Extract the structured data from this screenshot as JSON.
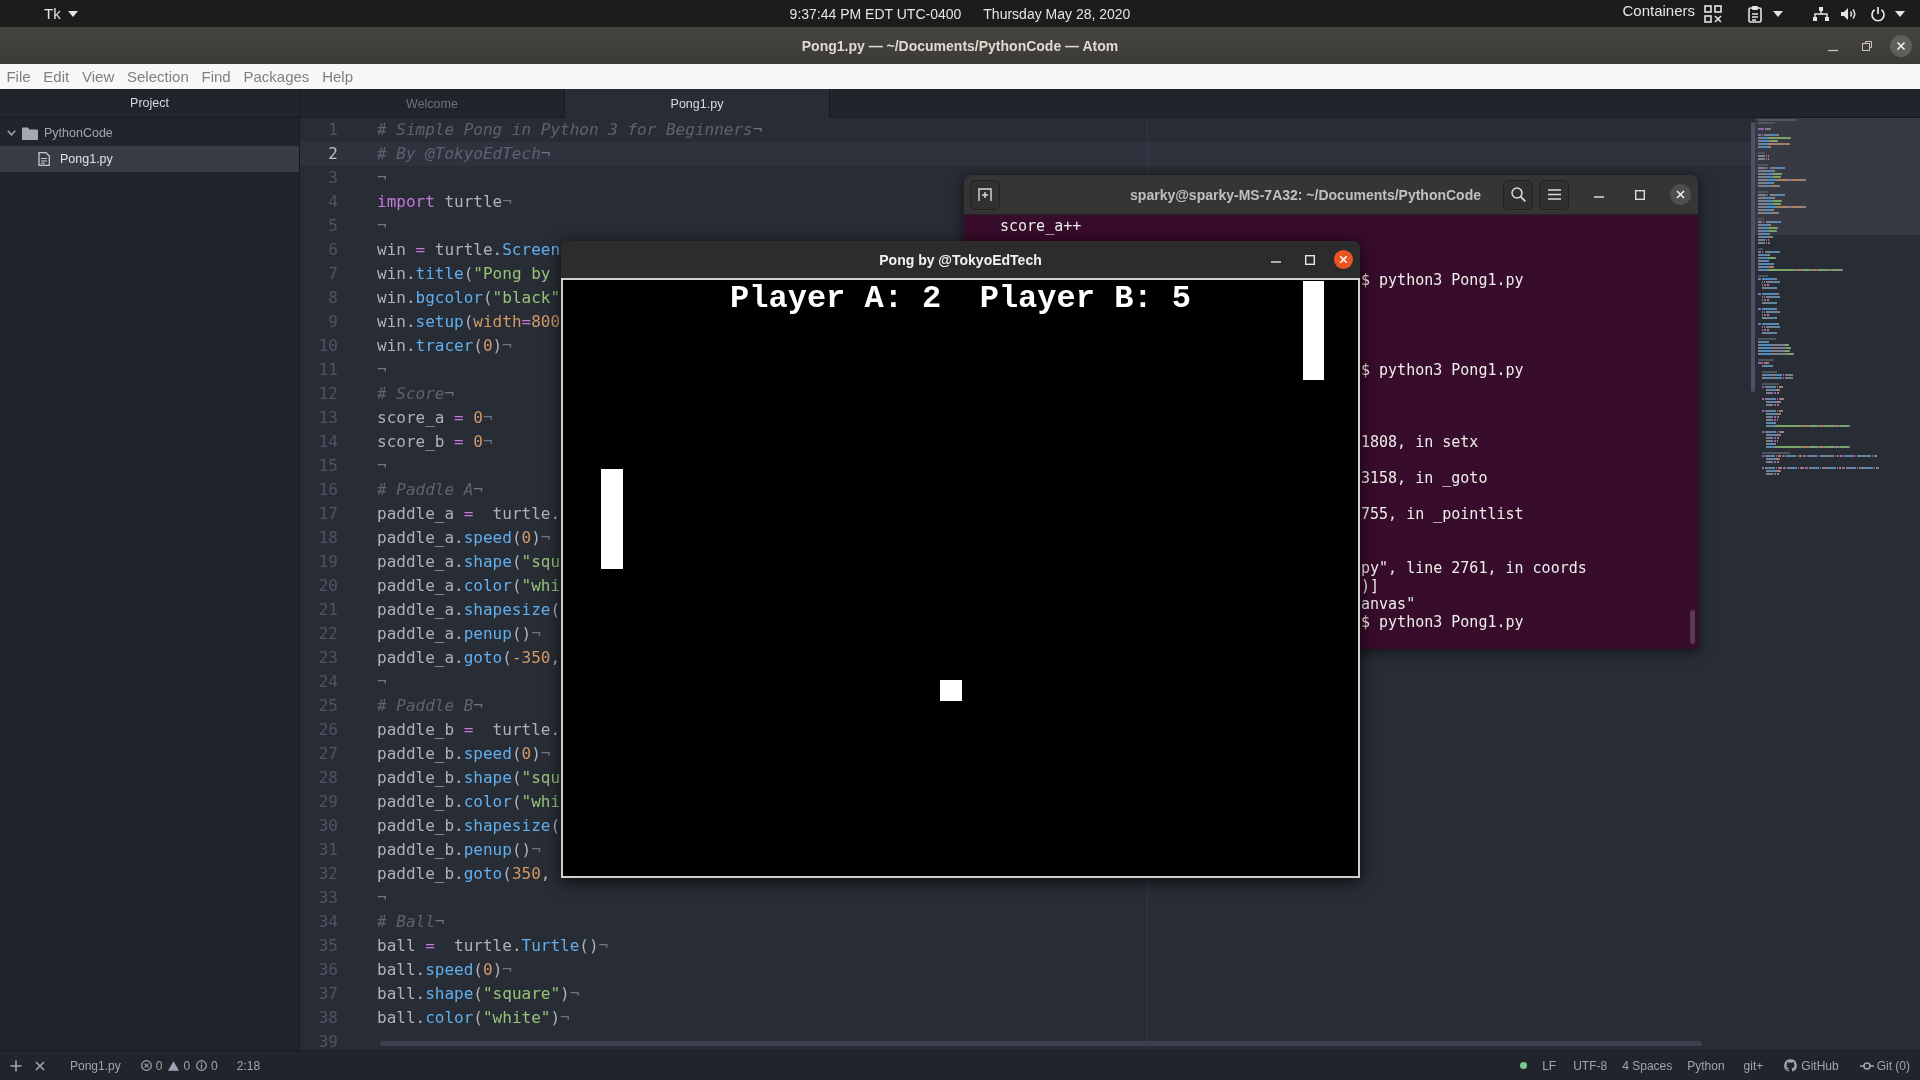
{
  "topbar": {
    "app_menu": "Tk",
    "clock": "9:37:44 PM EDT UTC-0400",
    "date": "Thursday May 28, 2020",
    "indicator": "Containers"
  },
  "window": {
    "title": "Pong1.py — ~/Documents/PythonCode — Atom"
  },
  "menu": [
    "File",
    "Edit",
    "View",
    "Selection",
    "Find",
    "Packages",
    "Help"
  ],
  "tree_view": {
    "header": "Project",
    "items": [
      {
        "label": "PythonCode",
        "kind": "folder",
        "expanded": true,
        "selected": false,
        "children": [
          {
            "label": "Pong1.py",
            "kind": "file",
            "selected": true
          }
        ]
      }
    ]
  },
  "tabs": [
    {
      "label": "Welcome",
      "selected": false
    },
    {
      "label": "Pong1.py",
      "selected": true
    }
  ],
  "editor": {
    "lines": [
      {
        "number": "1",
        "cursor_line": false,
        "tokens": [
          {
            "kind": "comment",
            "text": "# Simple Pong in Python 3 for Beginners"
          },
          {
            "kind": "eol",
            "text": "¬"
          }
        ]
      },
      {
        "number": "2",
        "cursor_line": true,
        "tokens": [
          {
            "kind": "comment",
            "text": "# By @TokyoEdTech"
          },
          {
            "kind": "eol",
            "text": "¬"
          }
        ]
      },
      {
        "number": "3",
        "cursor_line": false,
        "tokens": [
          {
            "kind": "eol",
            "text": "¬"
          }
        ]
      },
      {
        "number": "4",
        "cursor_line": false,
        "tokens": [
          {
            "kind": "keyword",
            "text": "import"
          },
          {
            "kind": "plain",
            "text": " turtle"
          },
          {
            "kind": "eol",
            "text": "¬"
          }
        ]
      },
      {
        "number": "5",
        "cursor_line": false,
        "tokens": [
          {
            "kind": "eol",
            "text": "¬"
          }
        ]
      },
      {
        "number": "6",
        "cursor_line": false,
        "tokens": [
          {
            "kind": "plain",
            "text": "win "
          },
          {
            "kind": "op",
            "text": "="
          },
          {
            "kind": "plain",
            "text": " turtle."
          },
          {
            "kind": "func",
            "text": "Screen"
          }
        ]
      },
      {
        "number": "7",
        "cursor_line": false,
        "tokens": [
          {
            "kind": "plain",
            "text": "win."
          },
          {
            "kind": "func",
            "text": "title"
          },
          {
            "kind": "plain",
            "text": "("
          },
          {
            "kind": "string",
            "text": "\"Pong by"
          }
        ]
      },
      {
        "number": "8",
        "cursor_line": false,
        "tokens": [
          {
            "kind": "plain",
            "text": "win."
          },
          {
            "kind": "func",
            "text": "bgcolor"
          },
          {
            "kind": "plain",
            "text": "("
          },
          {
            "kind": "string",
            "text": "\"black\""
          }
        ]
      },
      {
        "number": "9",
        "cursor_line": false,
        "tokens": [
          {
            "kind": "plain",
            "text": "win."
          },
          {
            "kind": "func",
            "text": "setup"
          },
          {
            "kind": "plain",
            "text": "("
          },
          {
            "kind": "number",
            "text": "width"
          },
          {
            "kind": "op",
            "text": "="
          },
          {
            "kind": "number",
            "text": "800"
          }
        ]
      },
      {
        "number": "10",
        "cursor_line": false,
        "tokens": [
          {
            "kind": "plain",
            "text": "win."
          },
          {
            "kind": "func",
            "text": "tracer"
          },
          {
            "kind": "plain",
            "text": "("
          },
          {
            "kind": "number",
            "text": "0"
          },
          {
            "kind": "plain",
            "text": ")"
          },
          {
            "kind": "eol",
            "text": "¬"
          }
        ]
      },
      {
        "number": "11",
        "cursor_line": false,
        "tokens": [
          {
            "kind": "eol",
            "text": "¬"
          }
        ]
      },
      {
        "number": "12",
        "cursor_line": false,
        "tokens": [
          {
            "kind": "comment",
            "text": "# Score"
          },
          {
            "kind": "eol",
            "text": "¬"
          }
        ]
      },
      {
        "number": "13",
        "cursor_line": false,
        "tokens": [
          {
            "kind": "plain",
            "text": "score_a "
          },
          {
            "kind": "op",
            "text": "="
          },
          {
            "kind": "number",
            "text": " 0"
          },
          {
            "kind": "eol",
            "text": "¬"
          }
        ]
      },
      {
        "number": "14",
        "cursor_line": false,
        "tokens": [
          {
            "kind": "plain",
            "text": "score_b "
          },
          {
            "kind": "op",
            "text": "="
          },
          {
            "kind": "number",
            "text": " 0"
          },
          {
            "kind": "eol",
            "text": "¬"
          }
        ]
      },
      {
        "number": "15",
        "cursor_line": false,
        "tokens": [
          {
            "kind": "eol",
            "text": "¬"
          }
        ]
      },
      {
        "number": "16",
        "cursor_line": false,
        "tokens": [
          {
            "kind": "comment",
            "text": "# Paddle A"
          },
          {
            "kind": "eol",
            "text": "¬"
          }
        ]
      },
      {
        "number": "17",
        "cursor_line": false,
        "tokens": [
          {
            "kind": "plain",
            "text": "paddle_a "
          },
          {
            "kind": "op",
            "text": "="
          },
          {
            "kind": "plain",
            "text": "  turtle."
          }
        ]
      },
      {
        "number": "18",
        "cursor_line": false,
        "tokens": [
          {
            "kind": "plain",
            "text": "paddle_a."
          },
          {
            "kind": "func",
            "text": "speed"
          },
          {
            "kind": "plain",
            "text": "("
          },
          {
            "kind": "number",
            "text": "0"
          },
          {
            "kind": "plain",
            "text": ")"
          },
          {
            "kind": "eol",
            "text": "¬"
          }
        ]
      },
      {
        "number": "19",
        "cursor_line": false,
        "tokens": [
          {
            "kind": "plain",
            "text": "paddle_a."
          },
          {
            "kind": "func",
            "text": "shape"
          },
          {
            "kind": "plain",
            "text": "("
          },
          {
            "kind": "string",
            "text": "\"squ"
          }
        ]
      },
      {
        "number": "20",
        "cursor_line": false,
        "tokens": [
          {
            "kind": "plain",
            "text": "paddle_a."
          },
          {
            "kind": "func",
            "text": "color"
          },
          {
            "kind": "plain",
            "text": "("
          },
          {
            "kind": "string",
            "text": "\"whi"
          }
        ]
      },
      {
        "number": "21",
        "cursor_line": false,
        "tokens": [
          {
            "kind": "plain",
            "text": "paddle_a."
          },
          {
            "kind": "func",
            "text": "shapesize"
          },
          {
            "kind": "plain",
            "text": "("
          }
        ]
      },
      {
        "number": "22",
        "cursor_line": false,
        "tokens": [
          {
            "kind": "plain",
            "text": "paddle_a."
          },
          {
            "kind": "func",
            "text": "penup"
          },
          {
            "kind": "plain",
            "text": "()"
          },
          {
            "kind": "eol",
            "text": "¬"
          }
        ]
      },
      {
        "number": "23",
        "cursor_line": false,
        "tokens": [
          {
            "kind": "plain",
            "text": "paddle_a."
          },
          {
            "kind": "func",
            "text": "goto"
          },
          {
            "kind": "plain",
            "text": "("
          },
          {
            "kind": "number",
            "text": "-350"
          },
          {
            "kind": "plain",
            "text": ","
          }
        ]
      },
      {
        "number": "24",
        "cursor_line": false,
        "tokens": [
          {
            "kind": "eol",
            "text": "¬"
          }
        ]
      },
      {
        "number": "25",
        "cursor_line": false,
        "tokens": [
          {
            "kind": "comment",
            "text": "# Paddle B"
          },
          {
            "kind": "eol",
            "text": "¬"
          }
        ]
      },
      {
        "number": "26",
        "cursor_line": false,
        "tokens": [
          {
            "kind": "plain",
            "text": "paddle_b "
          },
          {
            "kind": "op",
            "text": "="
          },
          {
            "kind": "plain",
            "text": "  turtle."
          }
        ]
      },
      {
        "number": "27",
        "cursor_line": false,
        "tokens": [
          {
            "kind": "plain",
            "text": "paddle_b."
          },
          {
            "kind": "func",
            "text": "speed"
          },
          {
            "kind": "plain",
            "text": "("
          },
          {
            "kind": "number",
            "text": "0"
          },
          {
            "kind": "plain",
            "text": ")"
          },
          {
            "kind": "eol",
            "text": "¬"
          }
        ]
      },
      {
        "number": "28",
        "cursor_line": false,
        "tokens": [
          {
            "kind": "plain",
            "text": "paddle_b."
          },
          {
            "kind": "func",
            "text": "shape"
          },
          {
            "kind": "plain",
            "text": "("
          },
          {
            "kind": "string",
            "text": "\"squ"
          }
        ]
      },
      {
        "number": "29",
        "cursor_line": false,
        "tokens": [
          {
            "kind": "plain",
            "text": "paddle_b."
          },
          {
            "kind": "func",
            "text": "color"
          },
          {
            "kind": "plain",
            "text": "("
          },
          {
            "kind": "string",
            "text": "\"whi"
          }
        ]
      },
      {
        "number": "30",
        "cursor_line": false,
        "tokens": [
          {
            "kind": "plain",
            "text": "paddle_b."
          },
          {
            "kind": "func",
            "text": "shapesize"
          },
          {
            "kind": "plain",
            "text": "("
          }
        ]
      },
      {
        "number": "31",
        "cursor_line": false,
        "tokens": [
          {
            "kind": "plain",
            "text": "paddle_b."
          },
          {
            "kind": "func",
            "text": "penup"
          },
          {
            "kind": "plain",
            "text": "()"
          },
          {
            "kind": "eol",
            "text": "¬"
          }
        ]
      },
      {
        "number": "32",
        "cursor_line": false,
        "tokens": [
          {
            "kind": "plain",
            "text": "paddle_b."
          },
          {
            "kind": "func",
            "text": "goto"
          },
          {
            "kind": "plain",
            "text": "("
          },
          {
            "kind": "number",
            "text": "350"
          },
          {
            "kind": "plain",
            "text": ","
          }
        ]
      },
      {
        "number": "33",
        "cursor_line": false,
        "tokens": [
          {
            "kind": "eol",
            "text": "¬"
          }
        ]
      },
      {
        "number": "34",
        "cursor_line": false,
        "tokens": [
          {
            "kind": "comment",
            "text": "# Ball"
          },
          {
            "kind": "eol",
            "text": "¬"
          }
        ]
      },
      {
        "number": "35",
        "cursor_line": false,
        "tokens": [
          {
            "kind": "plain",
            "text": "ball "
          },
          {
            "kind": "op",
            "text": "="
          },
          {
            "kind": "plain",
            "text": "  turtle."
          },
          {
            "kind": "func",
            "text": "Turtle"
          },
          {
            "kind": "plain",
            "text": "()"
          },
          {
            "kind": "eol",
            "text": "¬"
          }
        ]
      },
      {
        "number": "36",
        "cursor_line": false,
        "tokens": [
          {
            "kind": "plain",
            "text": "ball."
          },
          {
            "kind": "func",
            "text": "speed"
          },
          {
            "kind": "plain",
            "text": "("
          },
          {
            "kind": "number",
            "text": "0"
          },
          {
            "kind": "plain",
            "text": ")"
          },
          {
            "kind": "eol",
            "text": "¬"
          }
        ]
      },
      {
        "number": "37",
        "cursor_line": false,
        "tokens": [
          {
            "kind": "plain",
            "text": "ball."
          },
          {
            "kind": "func",
            "text": "shape"
          },
          {
            "kind": "plain",
            "text": "("
          },
          {
            "kind": "string",
            "text": "\"square\""
          },
          {
            "kind": "plain",
            "text": ")"
          },
          {
            "kind": "eol",
            "text": "¬"
          }
        ]
      },
      {
        "number": "38",
        "cursor_line": false,
        "tokens": [
          {
            "kind": "plain",
            "text": "ball."
          },
          {
            "kind": "func",
            "text": "color"
          },
          {
            "kind": "plain",
            "text": "("
          },
          {
            "kind": "string",
            "text": "\"white\""
          },
          {
            "kind": "plain",
            "text": ")"
          },
          {
            "kind": "eol",
            "text": "¬"
          }
        ]
      },
      {
        "number": "39",
        "cursor_line": false
      }
    ]
  },
  "terminal": {
    "title": "sparky@sparky-MS-7A32: ~/Documents/PythonCode",
    "lines": [
      "score_a++",
      "$ python3 Pong1.py",
      "$ python3 Pong1.py",
      "1808, in setx",
      "3158, in _goto",
      "755, in _pointlist",
      "py\", line 2761, in coords",
      ")]",
      "anvas\"",
      "$ python3 Pong1.py"
    ]
  },
  "game_window": {
    "title": "Pong by @TokyoEdTech",
    "score": "Player A: 2  Player B: 5"
  },
  "status_bar": {
    "file": "Pong1.py",
    "errors": "0",
    "warnings": "0",
    "infos": "0",
    "cursor": "2:18",
    "line_ending": "LF",
    "encoding": "UTF-8",
    "indentation": "4 Spaces",
    "grammar": "Python",
    "branch": "git+",
    "github": "GitHub",
    "git": "Git (0)"
  }
}
